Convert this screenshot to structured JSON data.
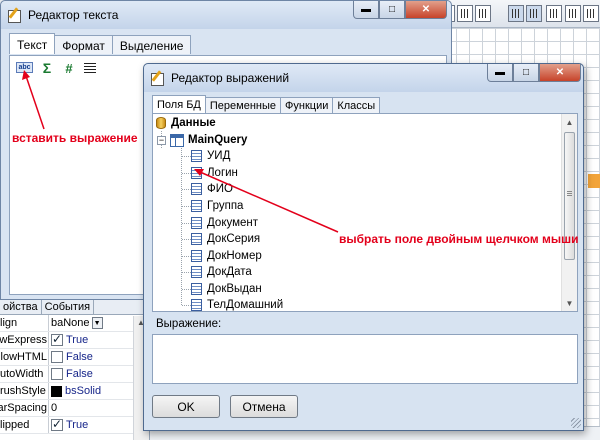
{
  "text_editor": {
    "title": "Редактор текста",
    "tabs": [
      "Текст",
      "Формат",
      "Выделение"
    ],
    "toolbar": {
      "insert_expression_icon_text": "abc"
    }
  },
  "expression_editor": {
    "title": "Редактор выражений",
    "tabs": [
      "Поля БД",
      "Переменные",
      "Функции",
      "Классы"
    ],
    "tree": {
      "root": "Данные",
      "query": "MainQuery",
      "fields": [
        "УИД",
        "Логин",
        "ФИО",
        "Группа",
        "Документ",
        "ДокСерия",
        "ДокНомер",
        "ДокДата",
        "ДокВыдан",
        "ТелДомашний"
      ]
    },
    "expression_label": "Выражение:",
    "expression_value": "",
    "ok_label": "OK",
    "cancel_label": "Отмена"
  },
  "inspector": {
    "tabs": [
      "ойства",
      "События"
    ],
    "rows": [
      {
        "name": "lign",
        "kind": "dropdown",
        "value": "baNone"
      },
      {
        "name": "llowExpress",
        "kind": "checkbox",
        "checked": true,
        "value": "True"
      },
      {
        "name": "llowHTML",
        "kind": "checkbox",
        "checked": false,
        "value": "False"
      },
      {
        "name": "utoWidth",
        "kind": "checkbox",
        "checked": false,
        "value": "False"
      },
      {
        "name": "rushStyle",
        "kind": "color",
        "value": "bsSolid",
        "swatch": "#000000"
      },
      {
        "name": "harSpacing",
        "kind": "text",
        "value": "0"
      },
      {
        "name": "lipped",
        "kind": "checkbox",
        "checked": true,
        "value": "True"
      }
    ]
  },
  "annotations": {
    "insert_expression": "вставить выражение",
    "pick_field": "выбрать поле двойным щелчком мыши"
  },
  "colors": {
    "annotation": "#e3001b",
    "band": "#f2a43a"
  }
}
